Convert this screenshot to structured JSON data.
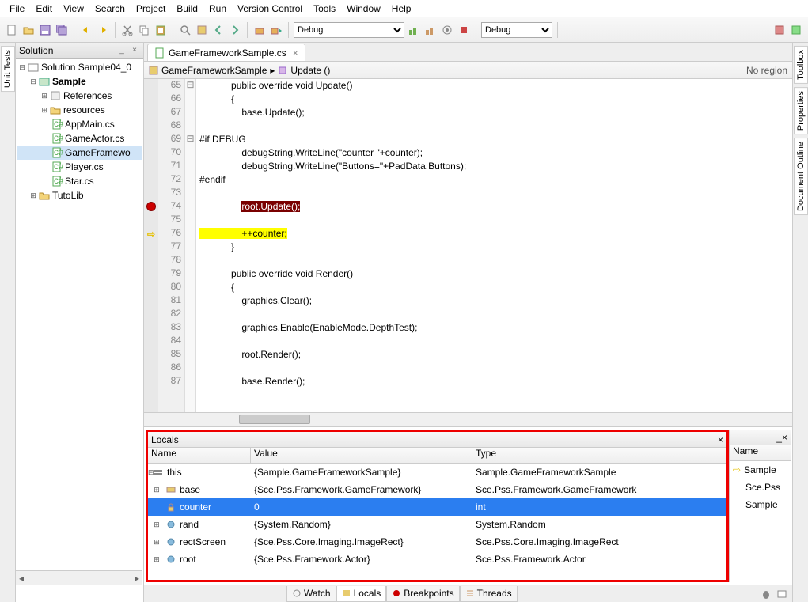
{
  "menu": {
    "file": "File",
    "edit": "Edit",
    "view": "View",
    "search": "Search",
    "project": "Project",
    "build": "Build",
    "run": "Run",
    "vc": "Version Control",
    "tools": "Tools",
    "window": "Window",
    "help": "Help"
  },
  "toolbar": {
    "config1": "Debug",
    "config2": "Debug"
  },
  "solution": {
    "title": "Solution",
    "root": "Solution Sample04_0",
    "project": "Sample",
    "refs": "References",
    "resources": "resources",
    "files": [
      "AppMain.cs",
      "GameActor.cs",
      "GameFramewo",
      "Player.cs",
      "Star.cs"
    ],
    "tutolib": "TutoLib"
  },
  "leftdock": {
    "unittests": "Unit Tests"
  },
  "rightdock": {
    "toolbox": "Toolbox",
    "properties": "Properties",
    "docoutline": "Document Outline"
  },
  "editor": {
    "tab": "GameFrameworkSample.cs",
    "crumb1": "GameFrameworkSample",
    "crumb2": "Update ()",
    "region": "No region",
    "lines": [
      {
        "n": 65,
        "f": "⊟",
        "h": "            <kw>public</kw> <kw>override</kw> <kw>void</kw> Update()"
      },
      {
        "n": 66,
        "h": "            {"
      },
      {
        "n": 67,
        "h": "                <kw>base</kw>.Update();"
      },
      {
        "n": 68,
        "h": ""
      },
      {
        "n": 69,
        "f": "⊟",
        "h": "<pp>#if DEBUG</pp>"
      },
      {
        "n": 70,
        "h": "                debugString.WriteLine(<str>\"counter \"</str>+counter);"
      },
      {
        "n": 71,
        "h": "                debugString.WriteLine(<str>\"Buttons=\"</str>+PadData.Buttons);"
      },
      {
        "n": 72,
        "h": "<pp>#endif</pp>"
      },
      {
        "n": 73,
        "h": ""
      },
      {
        "n": 74,
        "bp": true,
        "h": "                <span class='bpline'>root.Update();</span>"
      },
      {
        "n": 75,
        "h": ""
      },
      {
        "n": 76,
        "cur": true,
        "h": "<span class='curline'>                ++counter;</span>"
      },
      {
        "n": 77,
        "h": "            }"
      },
      {
        "n": 78,
        "h": ""
      },
      {
        "n": 79,
        "h": "            <kw>public</kw> <kw>override</kw> <kw>void</kw> Render()"
      },
      {
        "n": 80,
        "h": "            {"
      },
      {
        "n": 81,
        "h": "                graphics.Clear();"
      },
      {
        "n": 82,
        "h": ""
      },
      {
        "n": 83,
        "h": "                graphics.Enable(EnableMode.DepthTest);"
      },
      {
        "n": 84,
        "h": ""
      },
      {
        "n": 85,
        "h": "                root.Render();"
      },
      {
        "n": 86,
        "h": ""
      },
      {
        "n": 87,
        "h": "                <kw>base</kw>.Render();"
      }
    ]
  },
  "locals": {
    "title": "Locals",
    "headers": {
      "name": "Name",
      "value": "Value",
      "type": "Type"
    },
    "rows": [
      {
        "name": "this",
        "value": "{Sample.GameFrameworkSample}",
        "type": "Sample.GameFrameworkSample",
        "exp": "⊟"
      },
      {
        "name": "base",
        "value": "{Sce.Pss.Framework.GameFramework}",
        "type": "Sce.Pss.Framework.GameFramework",
        "exp": "⊞",
        "indent": true,
        "icon": "brick"
      },
      {
        "name": "counter",
        "value": "0",
        "type": "int",
        "sel": true,
        "indent": true,
        "icon": "lock"
      },
      {
        "name": "rand",
        "value": "{System.Random}",
        "type": "System.Random",
        "exp": "⊞",
        "indent": true,
        "icon": "dot"
      },
      {
        "name": "rectScreen",
        "value": "{Sce.Pss.Core.Imaging.ImageRect}",
        "type": "Sce.Pss.Core.Imaging.ImageRect",
        "exp": "⊞",
        "indent": true,
        "icon": "dot"
      },
      {
        "name": "root",
        "value": "{Sce.Pss.Framework.Actor}",
        "type": "Sce.Pss.Framework.Actor",
        "exp": "⊞",
        "indent": true,
        "icon": "dot"
      }
    ],
    "right": {
      "header": "Name",
      "r1": "Sample",
      "r2": "Sce.Pss",
      "r3": "Sample"
    }
  },
  "bottomTabs": {
    "watch": "Watch",
    "locals": "Locals",
    "breakpoints": "Breakpoints",
    "threads": "Threads"
  }
}
